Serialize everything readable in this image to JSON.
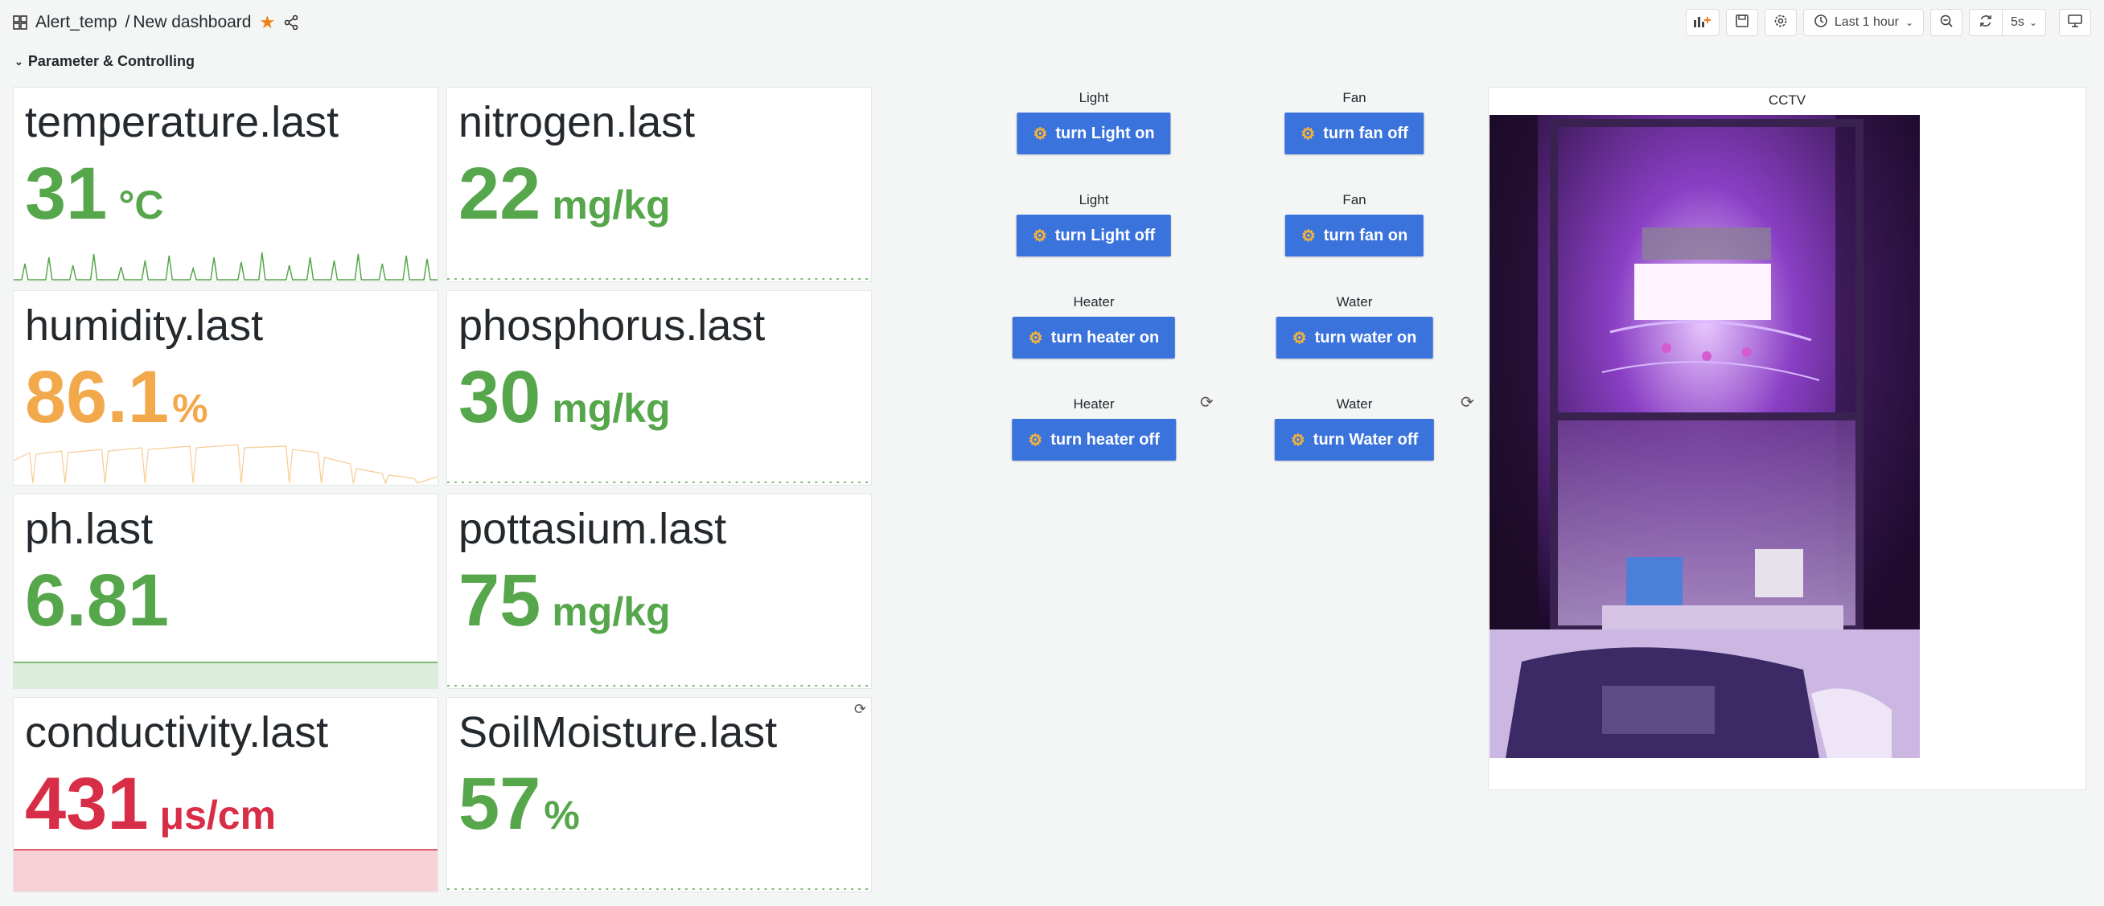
{
  "header": {
    "folder": "Alert_temp",
    "separator": "/",
    "dashboard": "New dashboard",
    "time_range": "Last 1 hour",
    "refresh_interval": "5s",
    "row_title": "Parameter & Controlling"
  },
  "stats": [
    {
      "title": "temperature.last",
      "value": "31",
      "unit": "°C",
      "color": "#56a64b"
    },
    {
      "title": "nitrogen.last",
      "value": "22",
      "unit": "mg/kg",
      "color": "#56a64b"
    },
    {
      "title": "humidity.last",
      "value": "86.1",
      "unit": "%",
      "color": "#f2a94b"
    },
    {
      "title": "phosphorus.last",
      "value": "30",
      "unit": "mg/kg",
      "color": "#56a64b"
    },
    {
      "title": "ph.last",
      "value": "6.81",
      "unit": "",
      "color": "#56a64b"
    },
    {
      "title": "pottasium.last",
      "value": "75",
      "unit": "mg/kg",
      "color": "#56a64b"
    },
    {
      "title": "conductivity.last",
      "value": "431",
      "unit": "μs/cm",
      "color": "#d82d46"
    },
    {
      "title": "SoilMoisture.last",
      "value": "57",
      "unit": "%",
      "color": "#56a64b"
    }
  ],
  "controls": [
    {
      "title": "Light",
      "label": "turn Light on"
    },
    {
      "title": "Fan",
      "label": "turn fan off"
    },
    {
      "title": "Light",
      "label": "turn Light off"
    },
    {
      "title": "Fan",
      "label": "turn fan on"
    },
    {
      "title": "Heater",
      "label": "turn heater on"
    },
    {
      "title": "Water",
      "label": "turn water on"
    },
    {
      "title": "Heater",
      "label": "turn heater off"
    },
    {
      "title": "Water",
      "label": "turn Water off"
    }
  ],
  "cctv": {
    "title": "CCTV"
  },
  "colors": {
    "accent": "#3b73dd",
    "star": "#f07d16",
    "green": "#56a64b",
    "orange": "#f2a94b",
    "red": "#d82d46"
  }
}
